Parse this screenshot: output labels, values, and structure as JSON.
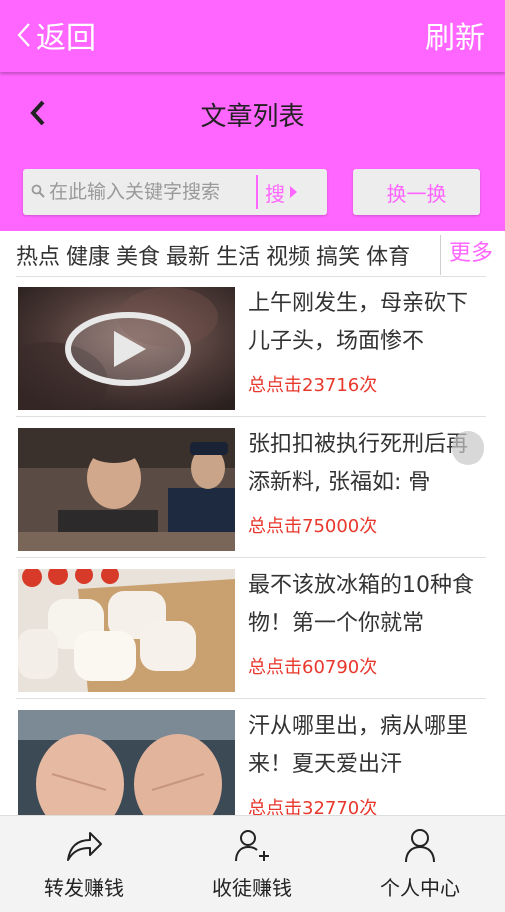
{
  "appbar": {
    "back_label": "返回",
    "refresh_label": "刷新",
    "color": "#ff66ff"
  },
  "header": {
    "title": "文章列表",
    "search_placeholder": "在此输入关键字搜索",
    "search_button_label": "搜",
    "switch_button_label": "换一换"
  },
  "categories": {
    "items": [
      "热点",
      "健康",
      "美食",
      "最新",
      "生活",
      "视频",
      "搞笑",
      "体育"
    ],
    "more_label": "更多"
  },
  "articles": [
    {
      "title": "上午刚发生，母亲砍下儿子头，场面惨不",
      "clicks": "总点击23716次",
      "thumb": "video-play-thumbnail"
    },
    {
      "title": "张扣扣被执行死刑后再添新料, 张福如: 骨",
      "clicks": "总点击75000次",
      "thumb": "courtroom-photo"
    },
    {
      "title": "最不该放冰箱的10种食物！第一个你就常",
      "clicks": "总点击60790次",
      "thumb": "steamed-buns-photo"
    },
    {
      "title": "汗从哪里出，病从哪里来！夏天爱出汗",
      "clicks": "总点击32770次",
      "thumb": "open-palms-photo"
    }
  ],
  "bottom_nav": [
    {
      "label": "转发赚钱",
      "icon": "share-icon"
    },
    {
      "label": "收徒赚钱",
      "icon": "add-user-icon"
    },
    {
      "label": "个人中心",
      "icon": "user-icon"
    }
  ],
  "colors": {
    "accent": "#ff66ff",
    "click_count": "#e8372c"
  }
}
